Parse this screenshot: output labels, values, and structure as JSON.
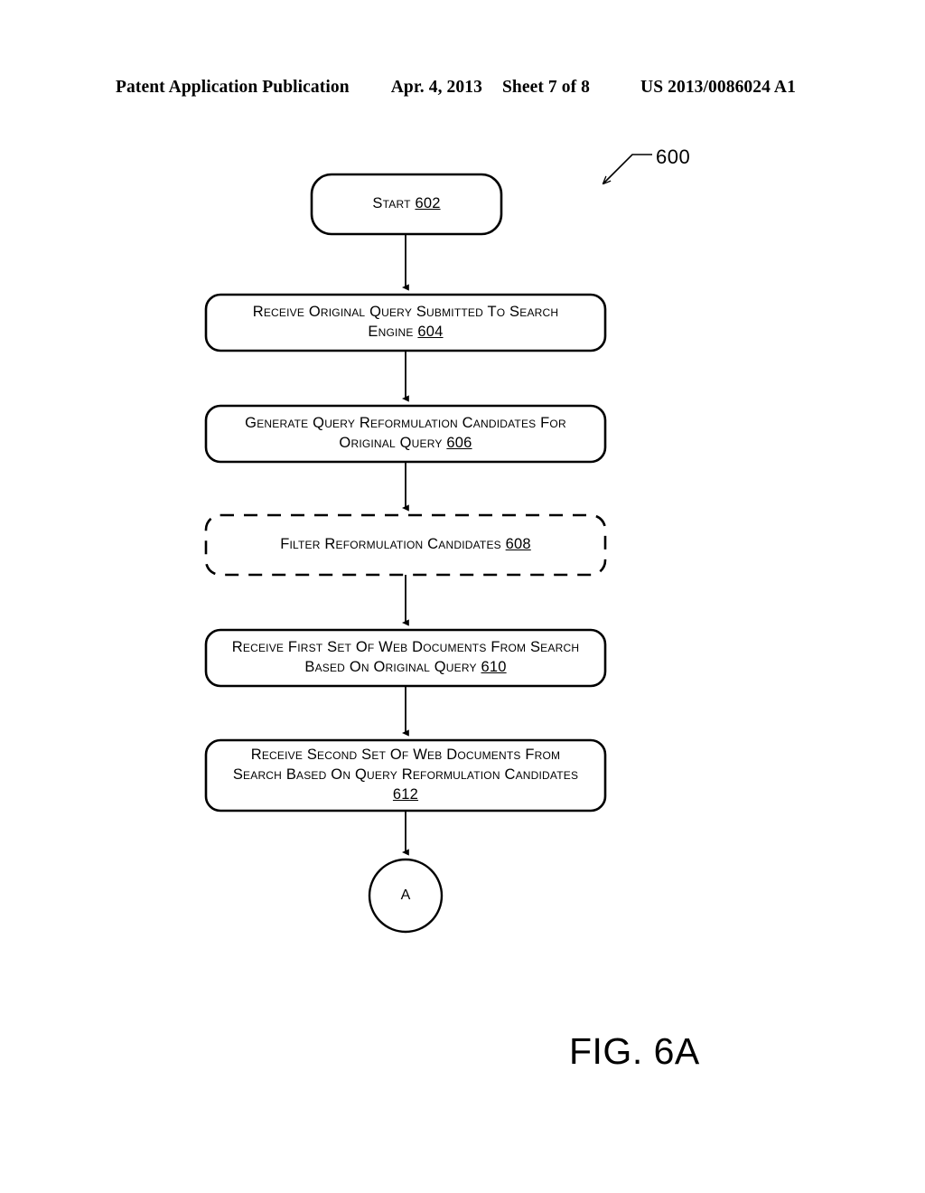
{
  "header": {
    "publication": "Patent Application Publication",
    "date": "Apr. 4, 2013",
    "sheet": "Sheet 7 of 8",
    "patent_number": "US 2013/0086024 A1"
  },
  "figure": {
    "caption": "FIG. 6A",
    "diagram_reference": "600",
    "nodes": [
      {
        "id": "start",
        "shape": "rounded-rect",
        "border": "solid",
        "lines": [
          "Start "
        ],
        "ref": "602"
      },
      {
        "id": "step-604",
        "shape": "rounded-rect",
        "border": "solid",
        "lines": [
          "Receive Original Query Submitted To Search",
          "Engine "
        ],
        "ref": "604"
      },
      {
        "id": "step-606",
        "shape": "rounded-rect",
        "border": "solid",
        "lines": [
          "Generate Query Reformulation Candidates For",
          "Original Query "
        ],
        "ref": "606"
      },
      {
        "id": "step-608",
        "shape": "rounded-rect",
        "border": "dashed",
        "lines": [
          "Filter Reformulation Candidates "
        ],
        "ref": "608"
      },
      {
        "id": "step-610",
        "shape": "rounded-rect",
        "border": "solid",
        "lines": [
          "Receive First Set Of Web Documents From Search",
          "Based On Original Query "
        ],
        "ref": "610"
      },
      {
        "id": "step-612",
        "shape": "rounded-rect",
        "border": "solid",
        "lines": [
          "Receive Second Set Of Web Documents From",
          "Search Based On Query Reformulation Candidates",
          ""
        ],
        "ref": "612"
      },
      {
        "id": "connector-a",
        "shape": "circle",
        "border": "solid",
        "label": "A"
      }
    ],
    "colors": {
      "stroke": "#000000",
      "fill": "#ffffff",
      "text": "#000000"
    }
  }
}
